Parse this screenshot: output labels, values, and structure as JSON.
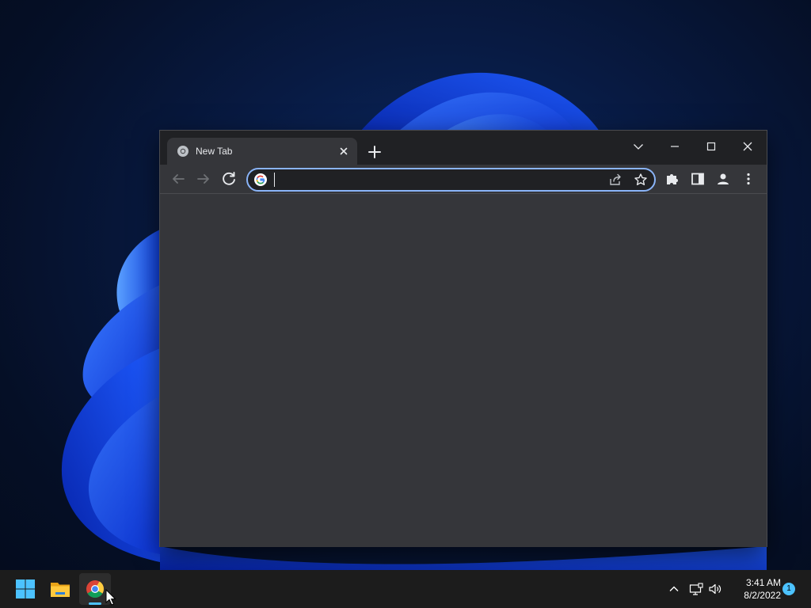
{
  "browser": {
    "tab": {
      "title": "New Tab",
      "favicon": "chrome-icon"
    },
    "new_tab_icon": "plus-icon",
    "window_controls": [
      "tab-search-icon",
      "minimize-icon",
      "maximize-icon",
      "close-icon"
    ],
    "toolbar": {
      "back_icon": "arrow-left-icon",
      "forward_icon": "arrow-right-icon",
      "reload_icon": "reload-icon",
      "omnibox": {
        "value": "",
        "placeholder": "",
        "search_engine_icon": "google-g-icon"
      },
      "omnibox_actions": [
        "share-icon",
        "star-icon"
      ],
      "extensions_icon": "puzzle-icon",
      "side_panel_icon": "side-panel-icon",
      "profile_icon": "profile-icon",
      "menu_icon": "kebab-menu-icon"
    },
    "theme": {
      "frame": "#202124",
      "toolbar": "#35363a",
      "accent": "#8ab4f8"
    }
  },
  "taskbar": {
    "apps": [
      {
        "name": "Start",
        "icon": "windows-start-icon"
      },
      {
        "name": "File Explorer",
        "icon": "folder-icon"
      },
      {
        "name": "Google Chrome",
        "icon": "chrome-icon",
        "active": true
      }
    ],
    "tray": {
      "overflow_icon": "chevron-up-icon",
      "network_icon": "network-icon",
      "volume_icon": "volume-icon",
      "time": "3:41 AM",
      "date": "8/2/2022",
      "notification_count": "1"
    },
    "accent": "#4cc2ff"
  }
}
